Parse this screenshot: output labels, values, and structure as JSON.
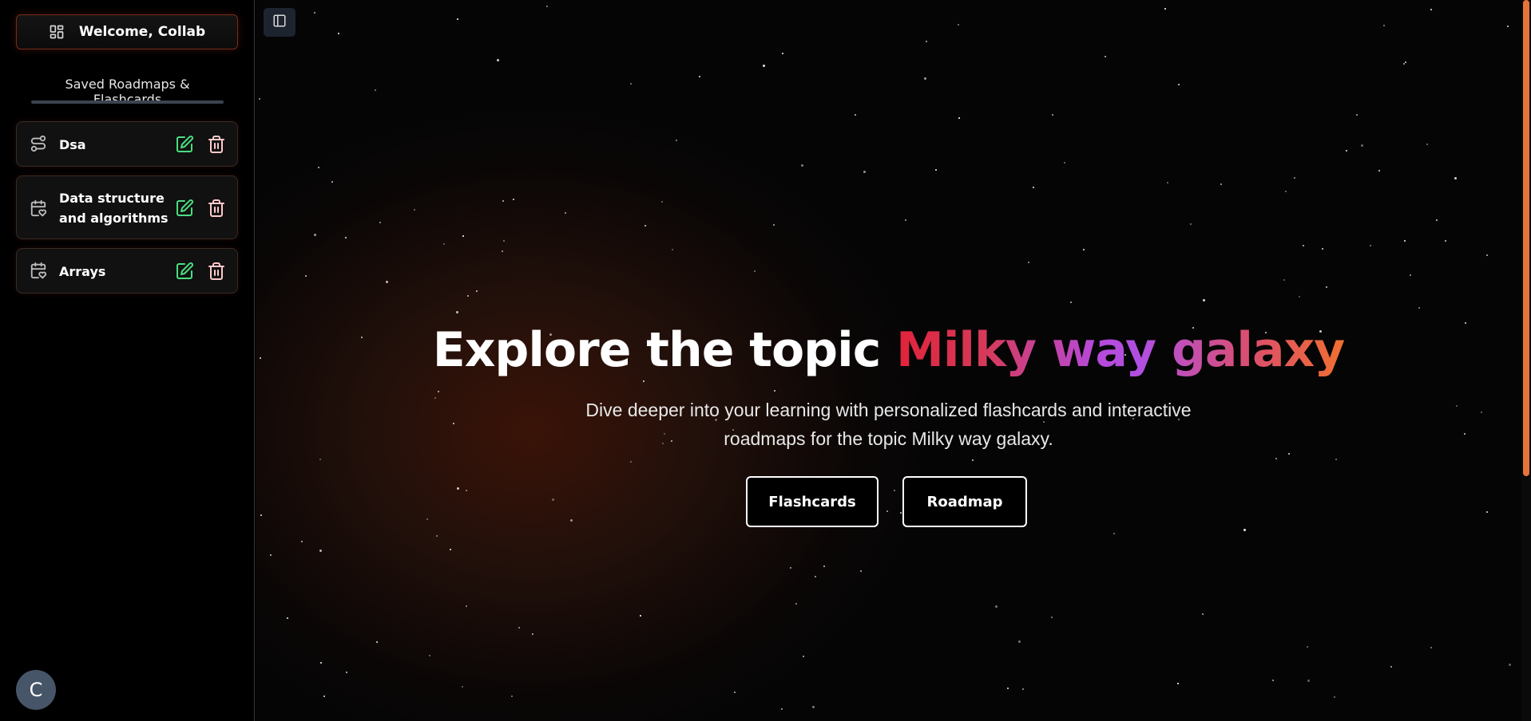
{
  "sidebar": {
    "welcome_label": "Welcome, Collab",
    "saved_heading": "Saved Roadmaps & Flashcards",
    "items": [
      {
        "label": "Dsa",
        "type": "roadmap"
      },
      {
        "label": "Data structure and algorithms",
        "type": "flashcards"
      },
      {
        "label": "Arrays",
        "type": "flashcards"
      }
    ],
    "avatar_initial": "C"
  },
  "hero": {
    "title_prefix": "Explore the topic ",
    "topic": "Milky way galaxy",
    "subtitle_line1": "Dive deeper into your learning with personalized flashcards and interactive",
    "subtitle_line2": "roadmaps for the topic Milky way galaxy.",
    "flashcards_label": "Flashcards",
    "roadmap_label": "Roadmap"
  },
  "colors": {
    "edit_icon": "#4ade80",
    "delete_icon": "#fecaca",
    "avatar_bg": "#475569",
    "scroll_thumb": "#e8733a",
    "topic_gradient": [
      "#e1233a",
      "#b14fe0",
      "#f07030"
    ]
  },
  "icons": {
    "welcome": "dashboard-grid-icon",
    "roadmap_item": "route-icon",
    "flashcard_item": "calendar-heart-icon",
    "edit": "edit-pencil-icon",
    "delete": "trash-icon",
    "sidebar_toggle": "panel-left-icon"
  }
}
